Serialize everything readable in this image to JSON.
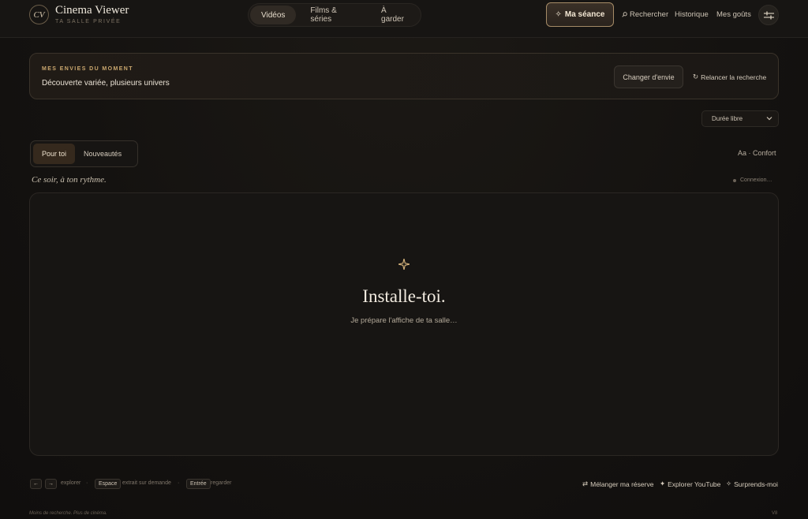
{
  "brand": {
    "logo_text": "CV",
    "title": "Cinema Viewer",
    "subtitle": "TA SALLE PRIVÉE"
  },
  "main_tabs": [
    {
      "label": "Vidéos",
      "active": true
    },
    {
      "label": "Films & séries",
      "active": false
    },
    {
      "label": "À garder",
      "active": false
    }
  ],
  "header": {
    "seance_icon": "sparkle-icon",
    "seance_label": "Ma séance",
    "search_label": "Rechercher",
    "history_label": "Historique",
    "tastes_label": "Mes goûts",
    "settings_icon": "sliders-icon"
  },
  "mood": {
    "heading": "MES ENVIES DU MOMENT",
    "value": "Découverte variée, plusieurs univers",
    "change_label": "Changer d'envie",
    "relaunch_label": "Relancer la recherche"
  },
  "duration": {
    "selected": "Durée libre"
  },
  "sub_tabs": [
    {
      "label": "Pour toi",
      "active": true
    },
    {
      "label": "Nouveautés",
      "active": false
    }
  ],
  "display_mode": "Aa · Confort",
  "tagline": "Ce soir, à ton rythme.",
  "connection_status": "Connexion…",
  "stage": {
    "icon": "sparkle-icon",
    "title": "Installe-toi.",
    "subtitle": "Je prépare l'affiche de ta salle…"
  },
  "shortcuts": {
    "prev_key": "←",
    "next_key": "→",
    "explore_text": "explorer",
    "space_key": "Espace",
    "space_text": "extrait sur demande",
    "enter_key": "Entrée",
    "enter_text": "regarder"
  },
  "footer_actions": {
    "shuffle_label": "Mélanger ma réserve",
    "youtube_label": "Explorer YouTube",
    "surprise_label": "Surprends-moi"
  },
  "footer": {
    "note": "Moins de recherche. Plus de cinéma.",
    "version": "V8"
  },
  "colors": {
    "background": "#131110",
    "accent": "#cba86f",
    "accent_border": "#a58b67",
    "text": "#e8e1d6"
  }
}
